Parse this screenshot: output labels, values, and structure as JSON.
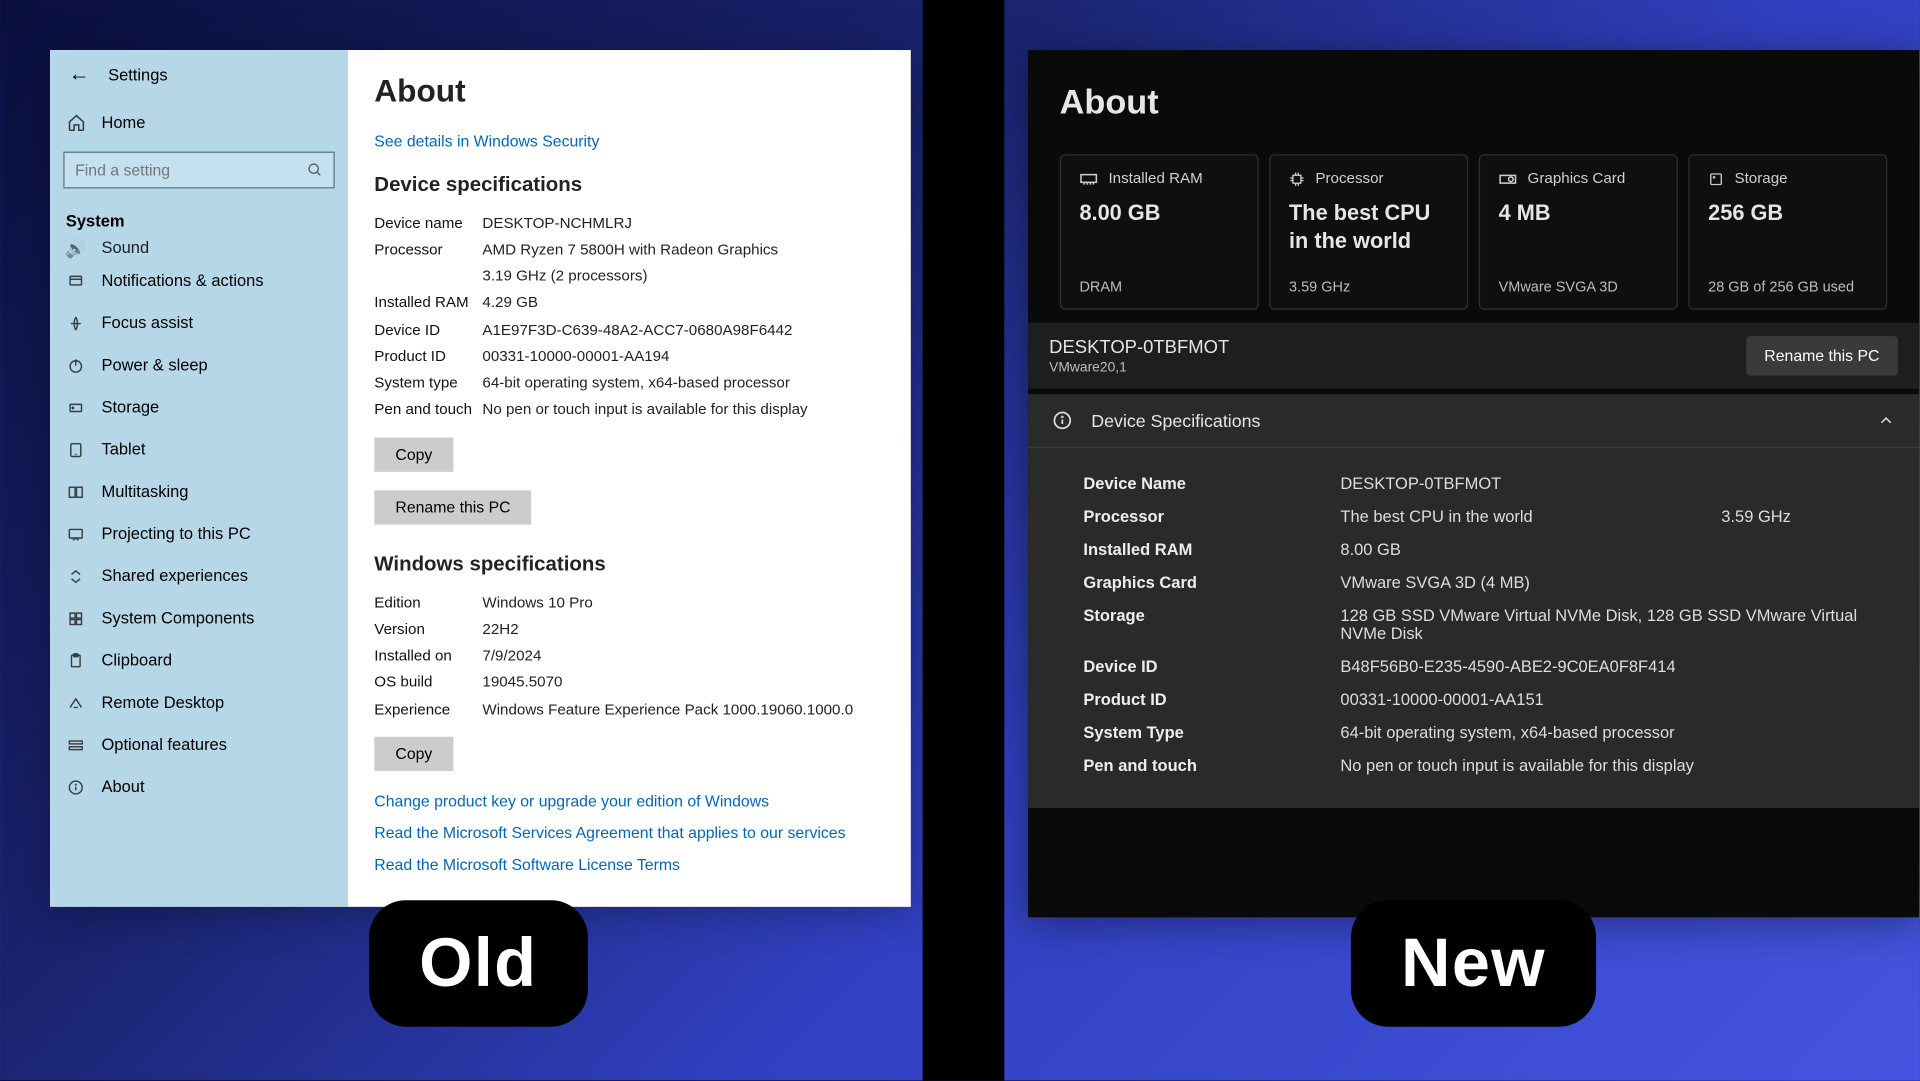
{
  "badges": {
    "old": "Old",
    "new": "New"
  },
  "old": {
    "header": {
      "title": "Settings"
    },
    "sidebar": {
      "home": "Home",
      "search_placeholder": "Find a setting",
      "system": "System",
      "items": [
        {
          "label": "Sound",
          "icon": "sound-icon"
        },
        {
          "label": "Notifications & actions",
          "icon": "notifications-icon"
        },
        {
          "label": "Focus assist",
          "icon": "focus-icon"
        },
        {
          "label": "Power & sleep",
          "icon": "power-icon"
        },
        {
          "label": "Storage",
          "icon": "storage-icon"
        },
        {
          "label": "Tablet",
          "icon": "tablet-icon"
        },
        {
          "label": "Multitasking",
          "icon": "multitasking-icon"
        },
        {
          "label": "Projecting to this PC",
          "icon": "projecting-icon"
        },
        {
          "label": "Shared experiences",
          "icon": "shared-icon"
        },
        {
          "label": "System Components",
          "icon": "components-icon"
        },
        {
          "label": "Clipboard",
          "icon": "clipboard-icon"
        },
        {
          "label": "Remote Desktop",
          "icon": "remote-icon"
        },
        {
          "label": "Optional features",
          "icon": "optional-icon"
        },
        {
          "label": "About",
          "icon": "about-icon"
        }
      ]
    },
    "about": {
      "title": "About",
      "security_link": "See details in Windows Security",
      "device_spec_header": "Device specifications",
      "device": {
        "name_label": "Device name",
        "name": "DESKTOP-NCHMLRJ",
        "proc_label": "Processor",
        "proc": "AMD Ryzen 7 5800H with Radeon Graphics",
        "proc2": "3.19 GHz  (2 processors)",
        "ram_label": "Installed RAM",
        "ram": "4.29 GB",
        "devid_label": "Device ID",
        "devid": "A1E97F3D-C639-48A2-ACC7-0680A98F6442",
        "prodid_label": "Product ID",
        "prodid": "00331-10000-00001-AA194",
        "systype_label": "System type",
        "systype": "64-bit operating system, x64-based processor",
        "pen_label": "Pen and touch",
        "pen": "No pen or touch input is available for this display"
      },
      "copy": "Copy",
      "rename": "Rename this PC",
      "win_spec_header": "Windows specifications",
      "win": {
        "edition_label": "Edition",
        "edition": "Windows 10 Pro",
        "version_label": "Version",
        "version": "22H2",
        "installed_label": "Installed on",
        "installed": "7/9/2024",
        "build_label": "OS build",
        "build": "19045.5070",
        "exp_label": "Experience",
        "exp": "Windows Feature Experience Pack 1000.19060.1000.0"
      },
      "links": {
        "product_key": "Change product key or upgrade your edition of Windows",
        "services": "Read the Microsoft Services Agreement that applies to our services",
        "license": "Read the Microsoft Software License Terms"
      }
    }
  },
  "new": {
    "title": "About",
    "cards": {
      "ram": {
        "label": "Installed RAM",
        "value": "8.00 GB",
        "sub": "DRAM"
      },
      "cpu": {
        "label": "Processor",
        "value": "The best CPU in the world",
        "sub": "3.59 GHz"
      },
      "gpu": {
        "label": "Graphics Card",
        "value": "4 MB",
        "sub": "VMware SVGA 3D"
      },
      "storage": {
        "label": "Storage",
        "value": "256 GB",
        "sub": "28 GB of 256 GB used"
      }
    },
    "pc": {
      "name": "DESKTOP-0TBFMOT",
      "model": "VMware20,1",
      "rename": "Rename this PC"
    },
    "spec_header": "Device Specifications",
    "specs": {
      "name_label": "Device Name",
      "name": "DESKTOP-0TBFMOT",
      "proc_label": "Processor",
      "proc": "The best CPU in the world",
      "proc_freq": "3.59 GHz",
      "ram_label": "Installed RAM",
      "ram": "8.00 GB",
      "gpu_label": "Graphics Card",
      "gpu": "VMware SVGA 3D (4 MB)",
      "storage_label": "Storage",
      "storage": "128 GB SSD VMware Virtual NVMe Disk, 128 GB SSD VMware Virtual NVMe Disk",
      "devid_label": "Device ID",
      "devid": "B48F56B0-E235-4590-ABE2-9C0EA0F8F414",
      "prodid_label": "Product ID",
      "prodid": "00331-10000-00001-AA151",
      "systype_label": "System Type",
      "systype": "64-bit operating system, x64-based processor",
      "pen_label": "Pen and touch",
      "pen": "No pen or touch input is available for this display"
    }
  }
}
